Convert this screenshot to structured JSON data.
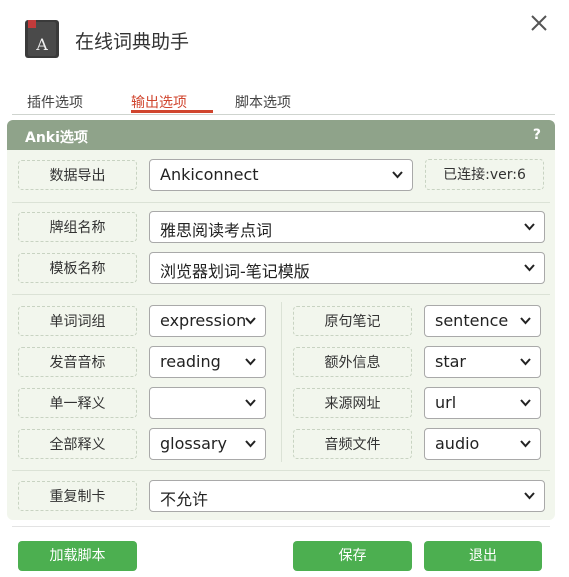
{
  "window": {
    "title": "在线词典助手",
    "app_icon": "book-icon",
    "close_icon": "close-icon"
  },
  "tabs": [
    {
      "label": "插件选项",
      "active": false
    },
    {
      "label": "输出选项",
      "active": true
    },
    {
      "label": "脚本选项",
      "active": false
    }
  ],
  "colors": {
    "accent": "#d0452e",
    "header": "#8fa38a",
    "panel_bg": "#f2f6ed",
    "button": "#4caf50"
  },
  "panel": {
    "title": "Anki选项",
    "help": "?"
  },
  "export": {
    "label": "数据导出",
    "value": "Ankiconnect",
    "status": "已连接:ver:6"
  },
  "deck": {
    "label": "牌组名称",
    "value": "雅思阅读考点词"
  },
  "model": {
    "label": "模板名称",
    "value": "浏览器划词-笔记模版"
  },
  "fields_left": [
    {
      "label": "单词词组",
      "value": "expression"
    },
    {
      "label": "发音音标",
      "value": "reading"
    },
    {
      "label": "单一释义",
      "value": ""
    },
    {
      "label": "全部释义",
      "value": "glossary"
    }
  ],
  "fields_right": [
    {
      "label": "原句笔记",
      "value": "sentence"
    },
    {
      "label": "额外信息",
      "value": "star"
    },
    {
      "label": "来源网址",
      "value": "url"
    },
    {
      "label": "音频文件",
      "value": "audio"
    }
  ],
  "duplicate": {
    "label": "重复制卡",
    "value": "不允许"
  },
  "buttons": {
    "load_script": "加载脚本",
    "save": "保存",
    "exit": "退出"
  }
}
